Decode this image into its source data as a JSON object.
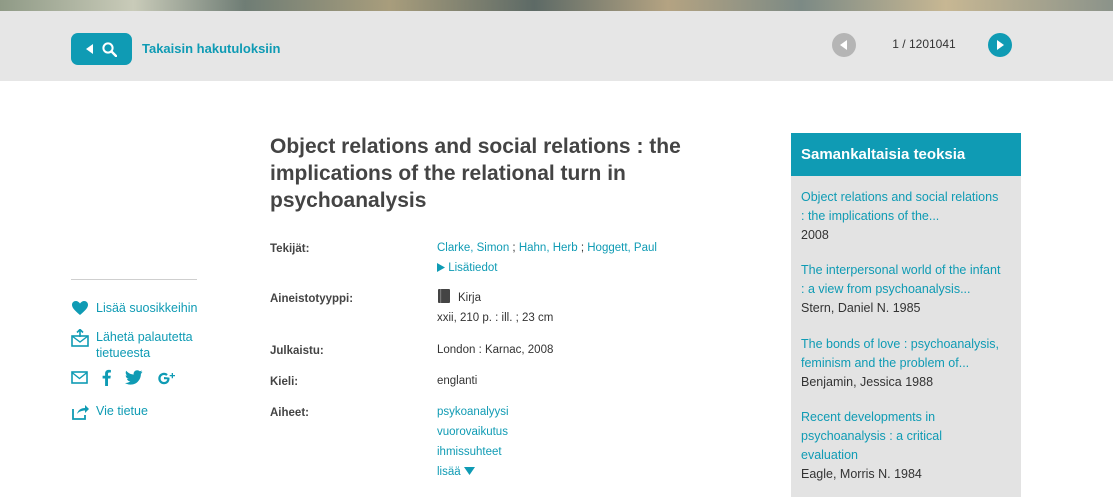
{
  "nav": {
    "back_label": "Takaisin hakutuloksiin",
    "pager_count": "1 / 1201041"
  },
  "actions": {
    "favorite": "Lisää suosikkeihin",
    "feedback": "Lähetä palautetta tietueesta",
    "export": "Vie tietue"
  },
  "record": {
    "title": "Object relations and social relations : the implications of the relational turn in psychoanalysis",
    "authors_label": "Tekijät:",
    "authors": [
      "Clarke, Simon",
      "Hahn, Herb",
      "Hoggett, Paul"
    ],
    "author_sep": ";",
    "more_info": "Lisätiedot",
    "format_label": "Aineistotyyppi:",
    "format": "Kirja",
    "extent": "xxii, 210 p. : ill. ; 23 cm",
    "published_label": "Julkaistu:",
    "published": "London : Karnac, 2008",
    "language_label": "Kieli:",
    "language": "englanti",
    "subjects_label": "Aiheet:",
    "subjects": [
      "psykoanalyysi",
      "vuorovaikutus",
      "ihmissuhteet"
    ],
    "more_subjects": "lisää"
  },
  "similar": {
    "heading": "Samankaltaisia teoksia",
    "items": [
      {
        "title_l1": "Object relations and social relations",
        "title_l2": ": the implications of the...",
        "meta": "2008"
      },
      {
        "title_l1": "The interpersonal world of the infant",
        "title_l2": ": a view from psychoanalysis...",
        "meta": "Stern, Daniel N. 1985"
      },
      {
        "title_l1": "The bonds of love : psychoanalysis,",
        "title_l2": "feminism and the problem of...",
        "meta": "Benjamin, Jessica 1988"
      },
      {
        "title_l1": "Recent developments in",
        "title_l2": "psychoanalysis : a critical",
        "title_l3": "evaluation",
        "meta": "Eagle, Morris N. 1984"
      }
    ]
  },
  "colors": {
    "accent": "#0f9bb4",
    "navbar_bg": "#e6e6e6",
    "panel_bg": "#e3e3e3"
  },
  "icons": {
    "back": "arrow-left-icon",
    "search": "search-icon",
    "prev": "chevron-left-icon",
    "next": "chevron-right-icon",
    "favorite": "heart-icon",
    "feedback": "envelope-upload-icon",
    "email": "envelope-icon",
    "facebook": "facebook-icon",
    "twitter": "twitter-icon",
    "googleplus": "google-plus-icon",
    "export": "share-arrow-icon",
    "book": "book-icon",
    "more_info": "triangle-right-icon",
    "more_subjects": "triangle-down-icon"
  }
}
